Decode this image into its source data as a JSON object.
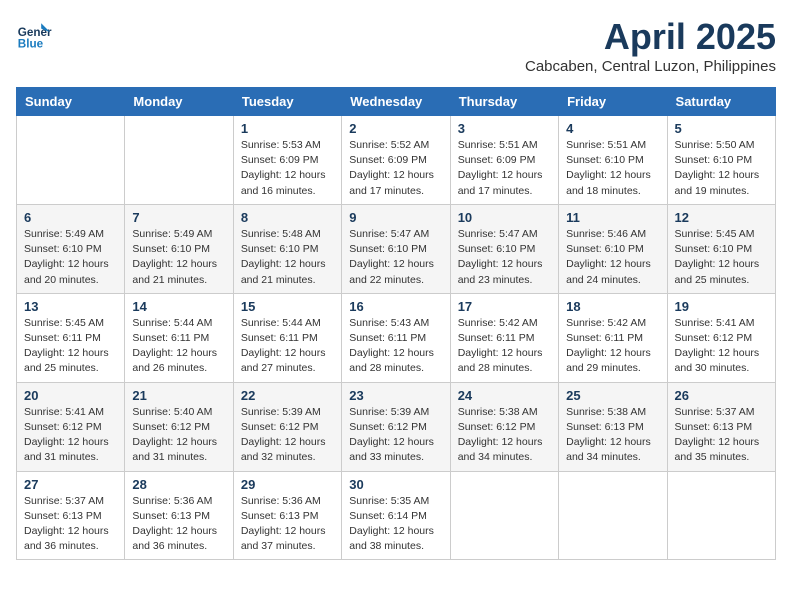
{
  "header": {
    "logo_line1": "General",
    "logo_line2": "Blue",
    "month": "April 2025",
    "location": "Cabcaben, Central Luzon, Philippines"
  },
  "weekdays": [
    "Sunday",
    "Monday",
    "Tuesday",
    "Wednesday",
    "Thursday",
    "Friday",
    "Saturday"
  ],
  "weeks": [
    [
      {
        "day": "",
        "detail": ""
      },
      {
        "day": "",
        "detail": ""
      },
      {
        "day": "1",
        "detail": "Sunrise: 5:53 AM\nSunset: 6:09 PM\nDaylight: 12 hours and 16 minutes."
      },
      {
        "day": "2",
        "detail": "Sunrise: 5:52 AM\nSunset: 6:09 PM\nDaylight: 12 hours and 17 minutes."
      },
      {
        "day": "3",
        "detail": "Sunrise: 5:51 AM\nSunset: 6:09 PM\nDaylight: 12 hours and 17 minutes."
      },
      {
        "day": "4",
        "detail": "Sunrise: 5:51 AM\nSunset: 6:10 PM\nDaylight: 12 hours and 18 minutes."
      },
      {
        "day": "5",
        "detail": "Sunrise: 5:50 AM\nSunset: 6:10 PM\nDaylight: 12 hours and 19 minutes."
      }
    ],
    [
      {
        "day": "6",
        "detail": "Sunrise: 5:49 AM\nSunset: 6:10 PM\nDaylight: 12 hours and 20 minutes."
      },
      {
        "day": "7",
        "detail": "Sunrise: 5:49 AM\nSunset: 6:10 PM\nDaylight: 12 hours and 21 minutes."
      },
      {
        "day": "8",
        "detail": "Sunrise: 5:48 AM\nSunset: 6:10 PM\nDaylight: 12 hours and 21 minutes."
      },
      {
        "day": "9",
        "detail": "Sunrise: 5:47 AM\nSunset: 6:10 PM\nDaylight: 12 hours and 22 minutes."
      },
      {
        "day": "10",
        "detail": "Sunrise: 5:47 AM\nSunset: 6:10 PM\nDaylight: 12 hours and 23 minutes."
      },
      {
        "day": "11",
        "detail": "Sunrise: 5:46 AM\nSunset: 6:10 PM\nDaylight: 12 hours and 24 minutes."
      },
      {
        "day": "12",
        "detail": "Sunrise: 5:45 AM\nSunset: 6:10 PM\nDaylight: 12 hours and 25 minutes."
      }
    ],
    [
      {
        "day": "13",
        "detail": "Sunrise: 5:45 AM\nSunset: 6:11 PM\nDaylight: 12 hours and 25 minutes."
      },
      {
        "day": "14",
        "detail": "Sunrise: 5:44 AM\nSunset: 6:11 PM\nDaylight: 12 hours and 26 minutes."
      },
      {
        "day": "15",
        "detail": "Sunrise: 5:44 AM\nSunset: 6:11 PM\nDaylight: 12 hours and 27 minutes."
      },
      {
        "day": "16",
        "detail": "Sunrise: 5:43 AM\nSunset: 6:11 PM\nDaylight: 12 hours and 28 minutes."
      },
      {
        "day": "17",
        "detail": "Sunrise: 5:42 AM\nSunset: 6:11 PM\nDaylight: 12 hours and 28 minutes."
      },
      {
        "day": "18",
        "detail": "Sunrise: 5:42 AM\nSunset: 6:11 PM\nDaylight: 12 hours and 29 minutes."
      },
      {
        "day": "19",
        "detail": "Sunrise: 5:41 AM\nSunset: 6:12 PM\nDaylight: 12 hours and 30 minutes."
      }
    ],
    [
      {
        "day": "20",
        "detail": "Sunrise: 5:41 AM\nSunset: 6:12 PM\nDaylight: 12 hours and 31 minutes."
      },
      {
        "day": "21",
        "detail": "Sunrise: 5:40 AM\nSunset: 6:12 PM\nDaylight: 12 hours and 31 minutes."
      },
      {
        "day": "22",
        "detail": "Sunrise: 5:39 AM\nSunset: 6:12 PM\nDaylight: 12 hours and 32 minutes."
      },
      {
        "day": "23",
        "detail": "Sunrise: 5:39 AM\nSunset: 6:12 PM\nDaylight: 12 hours and 33 minutes."
      },
      {
        "day": "24",
        "detail": "Sunrise: 5:38 AM\nSunset: 6:12 PM\nDaylight: 12 hours and 34 minutes."
      },
      {
        "day": "25",
        "detail": "Sunrise: 5:38 AM\nSunset: 6:13 PM\nDaylight: 12 hours and 34 minutes."
      },
      {
        "day": "26",
        "detail": "Sunrise: 5:37 AM\nSunset: 6:13 PM\nDaylight: 12 hours and 35 minutes."
      }
    ],
    [
      {
        "day": "27",
        "detail": "Sunrise: 5:37 AM\nSunset: 6:13 PM\nDaylight: 12 hours and 36 minutes."
      },
      {
        "day": "28",
        "detail": "Sunrise: 5:36 AM\nSunset: 6:13 PM\nDaylight: 12 hours and 36 minutes."
      },
      {
        "day": "29",
        "detail": "Sunrise: 5:36 AM\nSunset: 6:13 PM\nDaylight: 12 hours and 37 minutes."
      },
      {
        "day": "30",
        "detail": "Sunrise: 5:35 AM\nSunset: 6:14 PM\nDaylight: 12 hours and 38 minutes."
      },
      {
        "day": "",
        "detail": ""
      },
      {
        "day": "",
        "detail": ""
      },
      {
        "day": "",
        "detail": ""
      }
    ]
  ]
}
